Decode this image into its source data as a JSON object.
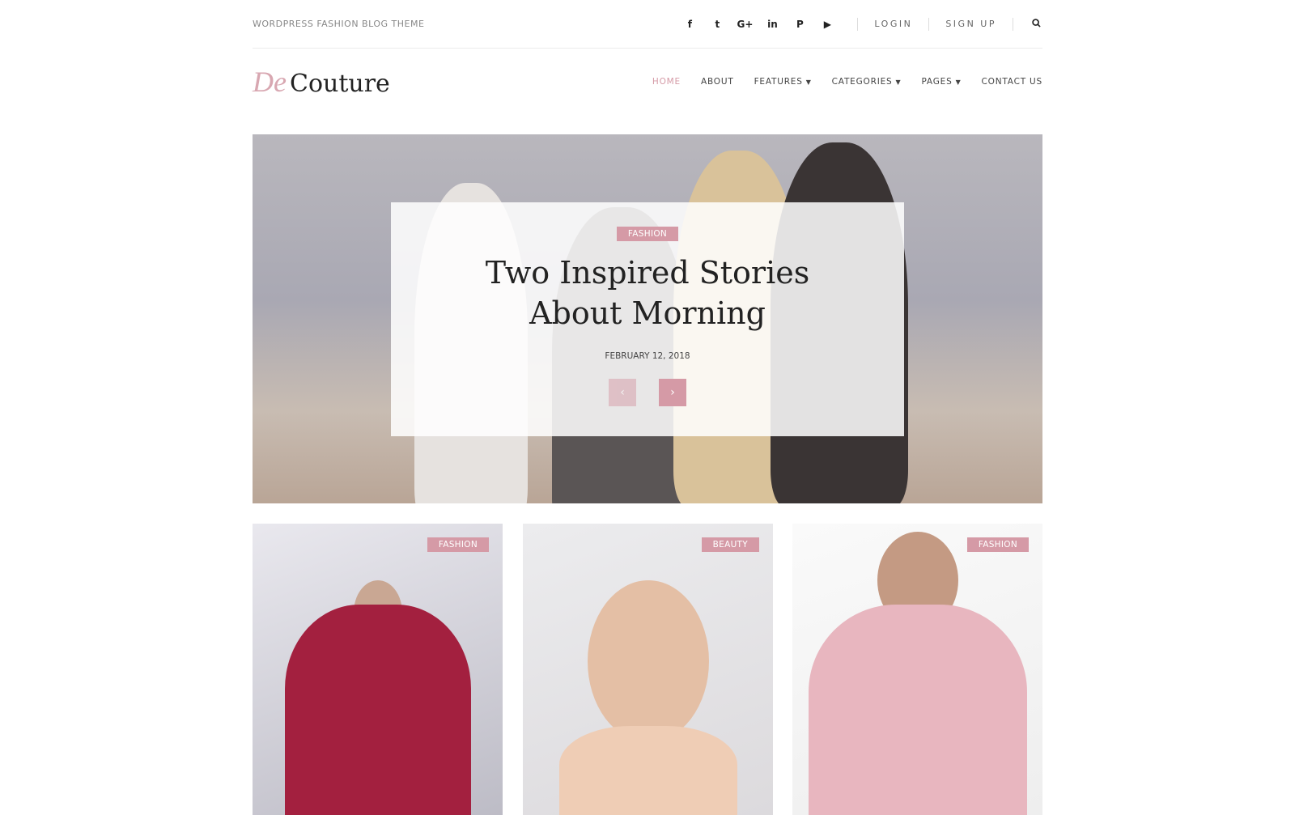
{
  "topbar": {
    "tagline": "WORDPRESS FASHION BLOG THEME",
    "social": [
      {
        "icon": "facebook-icon",
        "glyph": "f"
      },
      {
        "icon": "twitter-icon",
        "glyph": "t"
      },
      {
        "icon": "google-plus-icon",
        "glyph": "G+"
      },
      {
        "icon": "linkedin-icon",
        "glyph": "in"
      },
      {
        "icon": "pinterest-icon",
        "glyph": "P"
      },
      {
        "icon": "youtube-icon",
        "glyph": "▶"
      }
    ],
    "login": "LOGIN",
    "signup": "SIGN UP",
    "search_icon": "search-icon"
  },
  "logo": {
    "script": "De",
    "name": "Couture"
  },
  "nav": {
    "items": [
      {
        "label": "HOME",
        "active": true
      },
      {
        "label": "ABOUT"
      },
      {
        "label": "FEATURES",
        "dropdown": true
      },
      {
        "label": "CATEGORIES",
        "dropdown": true
      },
      {
        "label": "PAGES",
        "dropdown": true
      },
      {
        "label": "CONTACT US"
      }
    ]
  },
  "hero": {
    "category": "FASHION",
    "title_line1": "Two Inspired Stories",
    "title_line2": "About Morning",
    "date": "FEBRUARY 12, 2018",
    "prev": "‹",
    "next": "›"
  },
  "cards": [
    {
      "category": "FASHION"
    },
    {
      "category": "BEAUTY"
    },
    {
      "category": "FASHION"
    }
  ],
  "colors": {
    "accent": "#d59aa6",
    "text": "#222222"
  }
}
